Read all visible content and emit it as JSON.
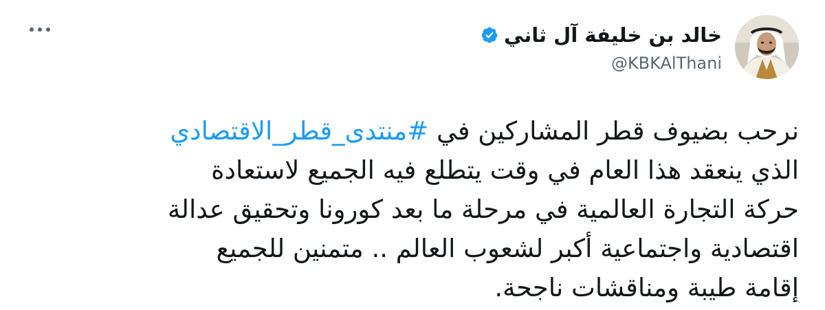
{
  "tweet": {
    "author": {
      "display_name": "خالد بن خليفة آل ثاني",
      "handle": "@KBKAlThani",
      "verified": true
    },
    "more_icon": "more-horizontal-icon",
    "verified_icon": "verified-badge-icon",
    "accent_color": "#1d9bf0",
    "body": {
      "line1_before": "نرحب بضيوف قطر المشاركين في ",
      "hashtag": "#منتدى_قطر_الاقتصادي",
      "line2": "الذي ينعقد هذا العام في وقت يتطلع فيه الجميع لاستعادة",
      "line3": "حركة التجارة العالمية في مرحلة ما بعد كورونا وتحقيق عدالة",
      "line4": "اقتصادية واجتماعية أكبر لشعوب العالم .. متمنين للجميع",
      "line5": "إقامة طيبة ومناقشات ناجحة."
    }
  }
}
